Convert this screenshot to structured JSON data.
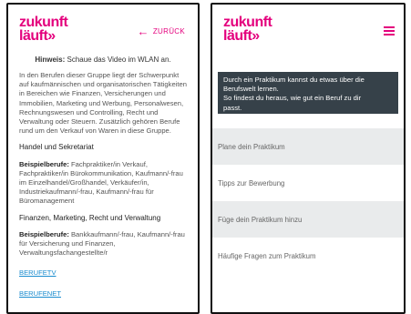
{
  "colors": {
    "brand": "#e4007d",
    "banner_bg": "#364149",
    "link": "#1a8ccf",
    "menu_shade": "#e9ebec"
  },
  "logo": {
    "line1": "zukunft",
    "line2": "läuft»"
  },
  "left": {
    "back_label": "ZURÜCK",
    "back_icon": "arrow-left-icon",
    "hinweis_label": "Hinweis:",
    "hinweis_text": " Schaue das Video im WLAN an.",
    "intro": "In den Berufen dieser Gruppe liegt der Schwerpunkt auf kaufmännischen und organisatorischen Tätigkeiten in Bereichen wie Finanzen, Versicherungen und Immobilien, Marketing und Werbung, Personalwesen, Rechnungswesen und Controlling, Recht und Verwaltung oder Steuern. Zusätzlich gehören Berufe rund um den Verkauf von Waren in diese Gruppe.",
    "sections": [
      {
        "heading": "Handel und Sekretariat",
        "examples_label": "Beispielberufe:",
        "examples": " Fachpraktiker/in Verkauf, Fachpraktiker/in Bürokommunikation, Kaufmann/-frau im Einzelhandel/Großhandel, Verkäufer/in, Industriekaufmann/-frau, Kaufmann/-frau für Büromanagement"
      },
      {
        "heading": "Finanzen, Marketing, Recht und Verwaltung",
        "examples_label": "Beispielberufe:",
        "examples": " Bankkaufmann/-frau, Kaufmann/-frau für Versicherung und Finanzen, Verwaltungsfachangestellte/r"
      }
    ],
    "links": [
      "BERUFETV",
      "BERUFENET"
    ]
  },
  "right": {
    "menu_icon": "hamburger-menu-icon",
    "banner_lines": [
      "Durch ein Praktikum kannst du etwas über die",
      "Berufswelt lernen.",
      "So findest du heraus, wie gut ein Beruf zu dir",
      "passt."
    ],
    "menu_items": [
      "Plane dein Praktikum",
      "Tipps zur Bewerbung",
      "Füge dein Praktikum hinzu",
      "Häufige Fragen zum Praktikum"
    ]
  }
}
